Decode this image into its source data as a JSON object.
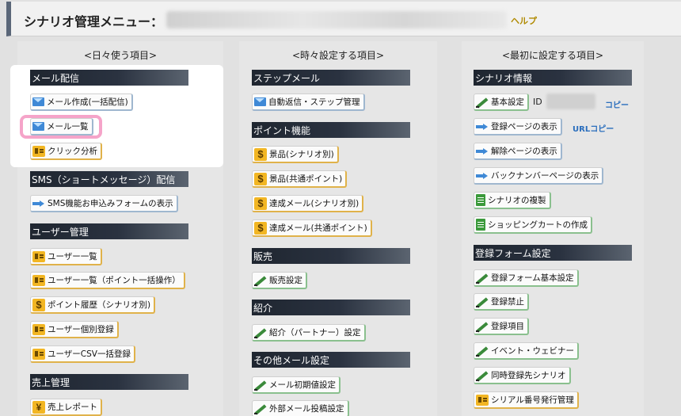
{
  "header": {
    "title": "シナリオ管理メニュー：",
    "help": "ヘルプ"
  },
  "columns": {
    "daily": "<日々使う項目>",
    "sometimes": "<時々設定する項目>",
    "first": "<最初に設定する項目>"
  },
  "left": {
    "mail_section": "メール配信",
    "mail_create": "メール作成(一括配信)",
    "mail_list": "メール一覧",
    "click_analysis": "クリック分析",
    "sms_section": "SMS（ショートメッセージ）配信",
    "sms_form": "SMS機能お申込みフォームの表示",
    "user_section": "ユーザー管理",
    "user_list": "ユーザー一覧",
    "user_list_points": "ユーザー一覧（ポイント一括操作）",
    "point_history": "ポイント履歴（シナリオ別)",
    "user_individual": "ユーザー個別登録",
    "user_csv": "ユーザーCSV一括登録",
    "sales_section": "売上管理",
    "sales_report": "売上レポート"
  },
  "middle": {
    "step_section": "ステップメール",
    "auto_reply": "自動返信・ステップ管理",
    "point_section": "ポイント機能",
    "prize_scenario": "景品(シナリオ別)",
    "prize_shared": "景品(共通ポイント)",
    "achieve_mail_scenario": "達成メール(シナリオ別)",
    "achieve_mail_shared": "達成メール(共通ポイント)",
    "sales_section": "販売",
    "sales_setting": "販売設定",
    "referral_section": "紹介",
    "referral_setting": "紹介（パートナー）設定",
    "other_mail_section": "その他メール設定",
    "mail_initial": "メール初期値設定",
    "external_mail": "外部メール投稿設定"
  },
  "right": {
    "scenario_section": "シナリオ情報",
    "basic_setting": "基本設定",
    "id_label": "ID",
    "copy": "コピー",
    "show_register_page": "登録ページの表示",
    "url_copy": "URLコピー",
    "show_cancel_page": "解除ページの表示",
    "show_backnumber": "バックナンバーページの表示",
    "duplicate_scenario": "シナリオの複製",
    "create_cart": "ショッピングカートの作成",
    "form_section": "登録フォーム設定",
    "form_basic": "登録フォーム基本設定",
    "register_ban": "登録禁止",
    "register_items": "登録項目",
    "event_webinar": "イベント・ウェビナー",
    "simultaneous_scenario": "同時登録先シナリオ",
    "serial_number": "シリアル番号発行管理"
  }
}
